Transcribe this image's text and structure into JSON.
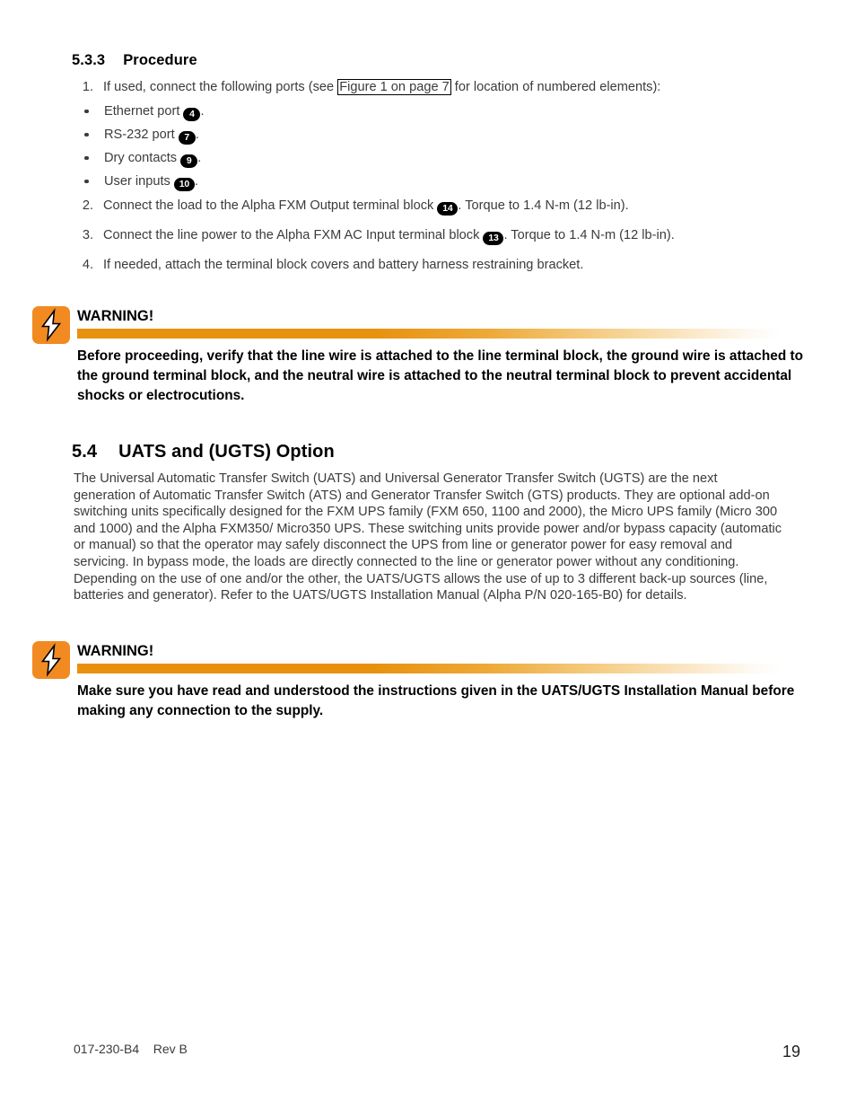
{
  "document": {
    "section_533": {
      "number": "5.3.3",
      "title": "Procedure"
    },
    "procedure_steps": {
      "step1": {
        "marker": "1.",
        "text_before_link": "If used, connect the following ports (see ",
        "link_text": "Figure 1 on page 7",
        "text_after_link": " for location of numbered elements):"
      },
      "bullets": [
        {
          "bullet_icon": "bullet-dot",
          "label": "Ethernet port ",
          "badge": "4",
          "suffix": "."
        },
        {
          "bullet_icon": "bullet-dot",
          "label": "RS-232 port ",
          "badge": "7",
          "suffix": "."
        },
        {
          "bullet_icon": "bullet-dot",
          "label": "Dry contacts ",
          "badge": "9",
          "suffix": "."
        },
        {
          "bullet_icon": "bullet-dot",
          "label": "User inputs ",
          "badge": "10",
          "suffix": "."
        }
      ],
      "step2": {
        "marker": "2.",
        "text_before_badge": "Connect the load to the Alpha FXM Output terminal block ",
        "badge": "14",
        "text_after_badge": ". Torque to 1.4 N-m (12 lb-in)."
      },
      "step3": {
        "marker": "3.",
        "text_before_badge": "Connect the line power to the Alpha FXM AC Input terminal block ",
        "badge": "13",
        "text_after_badge": ". Torque to 1.4 N-m (12 lb-in)."
      },
      "step4": {
        "marker": "4.",
        "text": "If needed, attach the terminal block covers and battery harness restraining bracket."
      }
    },
    "warning1": {
      "icon": "lightning-bolt-icon",
      "title": "WARNING!",
      "body": "Before proceeding, verify that the line wire is attached to the line terminal block, the ground wire is attached to the ground terminal block, and the neutral wire is attached to the neutral terminal block to prevent accidental shocks or electrocutions."
    },
    "section_54": {
      "number": "5.4",
      "title": "UATS and (UGTS) Option",
      "body": "The Universal Automatic Transfer Switch (UATS) and Universal Generator Transfer Switch (UGTS) are the next generation of Automatic Transfer Switch (ATS) and Generator Transfer Switch (GTS) products. They are optional add-on switching units specifically designed for the FXM UPS family (FXM 650, 1100 and 2000), the Micro UPS family (Micro 300 and 1000) and the Alpha FXM350/ Micro350 UPS. These switching units provide power and/or bypass capacity (automatic or manual) so that the operator may safely disconnect the UPS from line or generator power for easy removal and servicing. In bypass mode, the loads are directly connected to the line or generator power without any conditioning. Depending on the use of one and/or the other, the UATS/UGTS allows the use of up to 3 different back-up sources (line, batteries and generator). Refer to the UATS/UGTS Installation Manual (Alpha P/N 020-165-B0) for details."
    },
    "warning2": {
      "icon": "lightning-bolt-icon",
      "title": "WARNING!",
      "body": "Make sure you have read and understood the instructions given in the UATS/UGTS Installation Manual before making any connection to the supply."
    },
    "footer": {
      "doc_number": "017-230-B4    Rev B",
      "page_number": "19"
    },
    "colors": {
      "warning_orange": "#F18A21",
      "bar_orange": "#E8910F",
      "body_text": "#3b3b3b",
      "heading_text": "#000000"
    }
  }
}
